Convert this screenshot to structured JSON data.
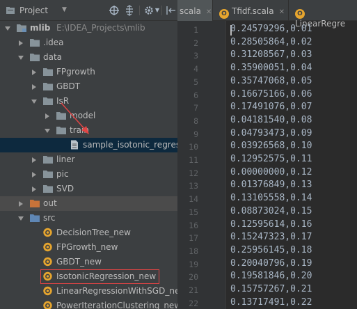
{
  "header": {
    "title": "Project"
  },
  "colors": {
    "folder": "#87939a",
    "scala_object": "#e6a52e",
    "selection": "#0d293e",
    "highlight_box": "#e04444",
    "arrow": "#e04444"
  },
  "tree": {
    "rows": [
      {
        "label": "mlib",
        "path": "E:\\IDEA_Projects\\mlib",
        "bold": true
      },
      {
        "label": ".idea"
      },
      {
        "label": "data"
      },
      {
        "label": "FPgrowth"
      },
      {
        "label": "GBDT"
      },
      {
        "label": "IsR"
      },
      {
        "label": "model"
      },
      {
        "label": "train"
      },
      {
        "label": "sample_isotonic_regression_data.txt"
      },
      {
        "label": "liner"
      },
      {
        "label": "pic"
      },
      {
        "label": "SVD"
      },
      {
        "label": "out"
      },
      {
        "label": "src"
      },
      {
        "label": "DecisionTree_new"
      },
      {
        "label": "FPGrowth_new"
      },
      {
        "label": "GBDT_new"
      },
      {
        "label": "IsotonicRegression_new"
      },
      {
        "label": "LinearRegressionWithSGD_new"
      },
      {
        "label": "PowerIterationClustering_new"
      }
    ]
  },
  "editor": {
    "tabs": [
      {
        "label": "scala",
        "icon": "none"
      },
      {
        "label": "Tfidf.scala",
        "icon": "scala-object-icon"
      },
      {
        "label": "LinearRegre",
        "icon": "scala-object-icon"
      }
    ],
    "lines": [
      "0.24579296,0.01",
      "0.28505864,0.02",
      "0.31208567,0.03",
      "0.35900051,0.04",
      "0.35747068,0.05",
      "0.16675166,0.06",
      "0.17491076,0.07",
      "0.04181540,0.08",
      "0.04793473,0.09",
      "0.03926568,0.10",
      "0.12952575,0.11",
      "0.00000000,0.12",
      "0.01376849,0.13",
      "0.13105558,0.14",
      "0.08873024,0.15",
      "0.12595614,0.16",
      "0.15247323,0.17",
      "0.25956145,0.18",
      "0.20040796,0.19",
      "0.19581846,0.20",
      "0.15757267,0.21",
      "0.13717491,0.22"
    ],
    "line_numbers": [
      "1",
      "2",
      "3",
      "4",
      "5",
      "6",
      "7",
      "8",
      "9",
      "10",
      "11",
      "12",
      "13",
      "14",
      "15",
      "16",
      "17",
      "18",
      "19",
      "20",
      "21",
      "22"
    ]
  }
}
